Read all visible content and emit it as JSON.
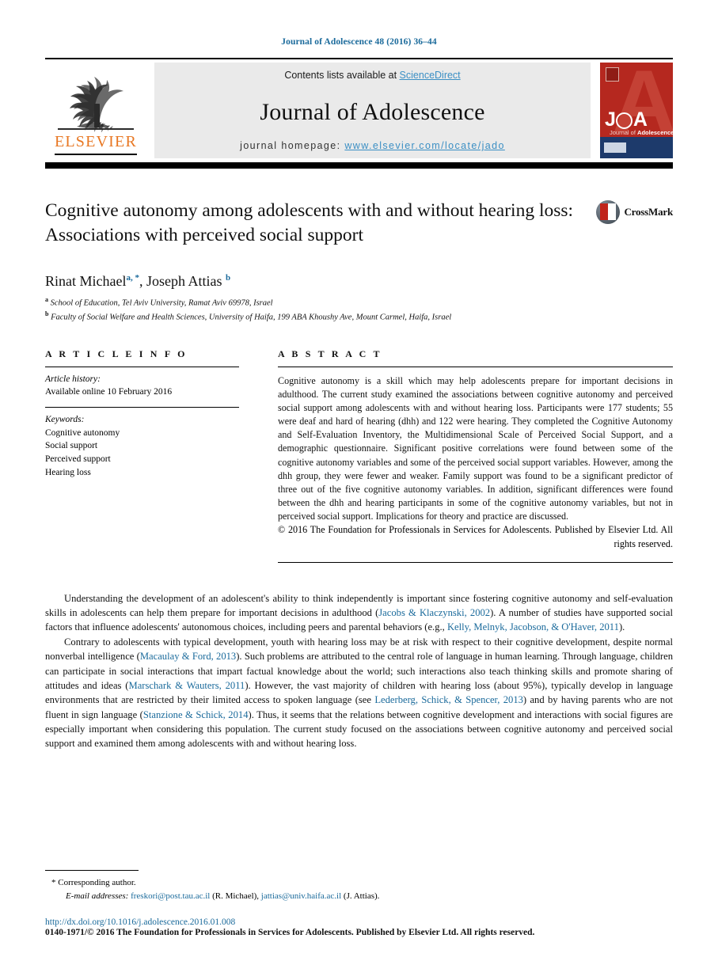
{
  "running_head": "Journal of Adolescence 48 (2016) 36–44",
  "masthead": {
    "contents_prefix": "Contents lists available at ",
    "contents_link": "ScienceDirect",
    "journal_title": "Journal of Adolescence",
    "homepage_prefix": "journal homepage: ",
    "homepage_url": "www.elsevier.com/locate/jado",
    "publisher_logo_text": "ELSEVIER",
    "cover": {
      "mark": "JOA",
      "subtitle_prefix": "Journal of ",
      "subtitle_bold": "Adolescence"
    }
  },
  "article": {
    "title": "Cognitive autonomy among adolescents with and without hearing loss: Associations with perceived social support",
    "crossmark_label": "CrossMark",
    "authors": [
      {
        "name": "Rinat Michael",
        "marks": "a, *"
      },
      {
        "name": "Joseph Attias",
        "marks": "b"
      }
    ],
    "authors_line_1_name": "Rinat Michael",
    "authors_line_1_sup": "a, *",
    "authors_line_2_name": "Joseph Attias",
    "authors_line_2_sup": "b",
    "affiliations": [
      {
        "mark": "a",
        "text": "School of Education, Tel Aviv University, Ramat Aviv 69978, Israel"
      },
      {
        "mark": "b",
        "text": "Faculty of Social Welfare and Health Sciences, University of Haifa, 199 ABA Khoushy Ave, Mount Carmel, Haifa, Israel"
      }
    ]
  },
  "article_info": {
    "heading": "A R T I C L E   I N F O",
    "history_label": "Article history:",
    "history_value": "Available online 10 February 2016",
    "keywords_label": "Keywords:",
    "keywords": [
      "Cognitive autonomy",
      "Social support",
      "Perceived support",
      "Hearing loss"
    ]
  },
  "abstract": {
    "heading": "A B S T R A C T",
    "text": "Cognitive autonomy is a skill which may help adolescents prepare for important decisions in adulthood. The current study examined the associations between cognitive autonomy and perceived social support among adolescents with and without hearing loss. Participants were 177 students; 55 were deaf and hard of hearing (dhh) and 122 were hearing. They completed the Cognitive Autonomy and Self-Evaluation Inventory, the Multidimensional Scale of Perceived Social Support, and a demographic questionnaire. Significant positive correlations were found between some of the cognitive autonomy variables and some of the perceived social support variables. However, among the dhh group, they were fewer and weaker. Family support was found to be a significant predictor of three out of the five cognitive autonomy variables. In addition, significant differences were found between the dhh and hearing participants in some of the cognitive autonomy variables, but not in perceived social support. Implications for theory and practice are discussed.",
    "copyright": "© 2016 The Foundation for Professionals in Services for Adolescents. Published by Elsevier Ltd. All rights reserved."
  },
  "body": {
    "paragraph_1": {
      "part_1": "Understanding the development of an adolescent's ability to think independently is important since fostering cognitive autonomy and self-evaluation skills in adolescents can help them prepare for important decisions in adulthood (",
      "ref_1": "Jacobs & Klaczynski, 2002",
      "part_2": "). A number of studies have supported social factors that influence adolescents' autonomous choices, including peers and parental behaviors (e.g., ",
      "ref_2": "Kelly, Melnyk, Jacobson, & O'Haver, 2011",
      "part_3": ")."
    },
    "paragraph_2": {
      "part_1": "Contrary to adolescents with typical development, youth with hearing loss may be at risk with respect to their cognitive development, despite normal nonverbal intelligence (",
      "ref_1": "Macaulay & Ford, 2013",
      "part_2": "). Such problems are attributed to the central role of language in human learning. Through language, children can participate in social interactions that impart factual knowledge about the world; such interactions also teach thinking skills and promote sharing of attitudes and ideas (",
      "ref_2": "Marschark & Wauters, 2011",
      "part_3": "). However, the vast majority of children with hearing loss (about 95%), typically develop in language environments that are restricted by their limited access to spoken language (see ",
      "ref_3": "Lederberg, Schick, & Spencer, 2013",
      "part_4": ") and by having parents who are not fluent in sign language (",
      "ref_4": "Stanzione & Schick, 2014",
      "part_5": "). Thus, it seems that the relations between cognitive development and interactions with social figures are especially important when considering this population. The current study focused on the associations between cognitive autonomy and perceived social support and examined them among adolescents with and without hearing loss."
    }
  },
  "footer": {
    "corresponding_mark": "*",
    "corresponding_text": "Corresponding author.",
    "emails_label": "E-mail addresses:",
    "email_1": "freskori@post.tau.ac.il",
    "email_1_owner": "(R. Michael),",
    "email_2": "jattias@univ.haifa.ac.il",
    "email_2_owner": "(J. Attias).",
    "doi": "http://dx.doi.org/10.1016/j.adolescence.2016.01.008",
    "issn_line": "0140-1971/© 2016 The Foundation for Professionals in Services for Adolescents. Published by Elsevier Ltd. All rights reserved."
  },
  "colors": {
    "link": "#1a6a9b",
    "sciencedirect": "#3b8fc4",
    "elsevier_orange": "#e87722",
    "cover_red": "#b5281f",
    "cover_blue": "#1d3a6b"
  }
}
